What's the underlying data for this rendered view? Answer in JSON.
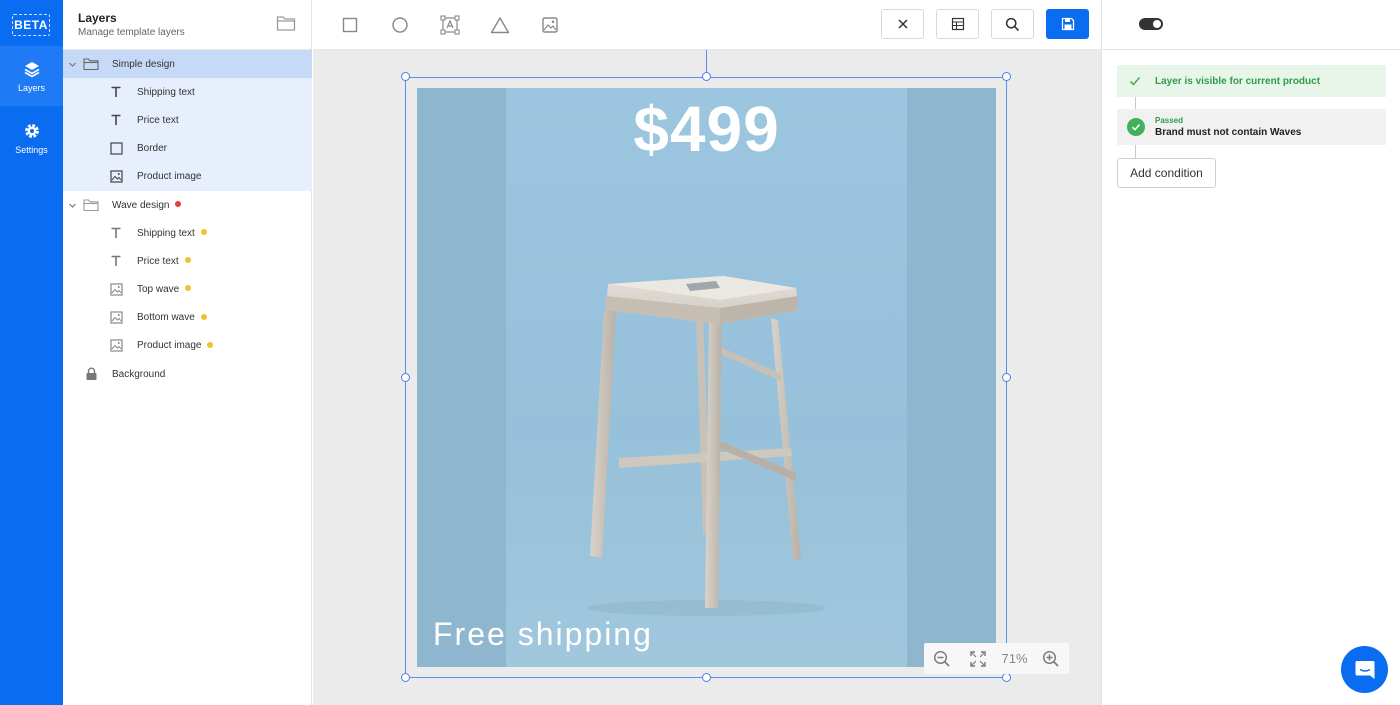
{
  "rail": {
    "beta": "BETA",
    "items": [
      {
        "label": "Layers",
        "icon": "layers-icon"
      },
      {
        "label": "Settings",
        "icon": "gear-icon"
      }
    ]
  },
  "panel": {
    "title": "Layers",
    "subtitle": "Manage template layers"
  },
  "layers": [
    {
      "label": "Simple design",
      "type": "group",
      "dot": null
    },
    {
      "label": "Shipping text",
      "type": "text",
      "dot": null
    },
    {
      "label": "Price text",
      "type": "text",
      "dot": null
    },
    {
      "label": "Border",
      "type": "shape",
      "dot": null
    },
    {
      "label": "Product image",
      "type": "image",
      "dot": null
    },
    {
      "label": "Wave design",
      "type": "group",
      "dot": "red"
    },
    {
      "label": "Shipping text",
      "type": "text",
      "dot": "yellow"
    },
    {
      "label": "Price text",
      "type": "text",
      "dot": "yellow"
    },
    {
      "label": "Top wave",
      "type": "image",
      "dot": "yellow"
    },
    {
      "label": "Bottom wave",
      "type": "image",
      "dot": "yellow"
    },
    {
      "label": "Product image",
      "type": "image",
      "dot": "yellow"
    },
    {
      "label": "Background",
      "type": "locked",
      "dot": null
    }
  ],
  "toolbar": {
    "tools": [
      "rectangle-tool-icon",
      "ellipse-tool-icon",
      "text-box-tool-icon",
      "triangle-tool-icon",
      "image-tool-icon"
    ],
    "buttons": [
      "close-icon",
      "table-icon",
      "search-icon",
      "save-icon"
    ]
  },
  "canvas": {
    "price": "$499",
    "shipping": "Free shipping",
    "zoom": "71%"
  },
  "conditions": {
    "visible_label": "Layer is visible for current product",
    "passed_label": "Passed",
    "rule_label": "Brand must not contain Waves",
    "add_condition": "Add condition"
  },
  "colors": {
    "accent": "#0a6cf0",
    "dot_red": "#e2423c",
    "dot_yellow": "#f2c12e",
    "success": "#43b05c"
  }
}
